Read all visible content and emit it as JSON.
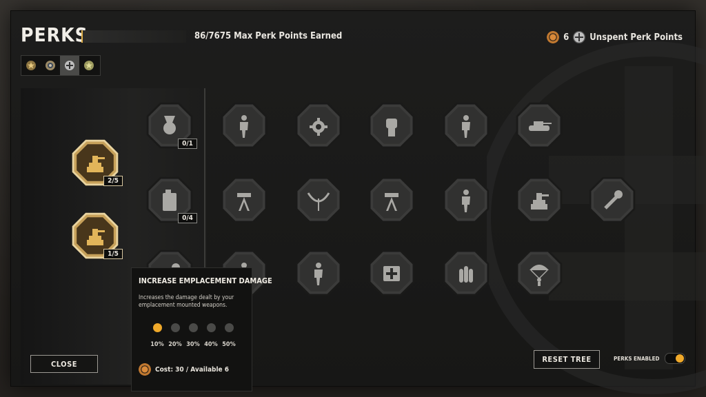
{
  "header": {
    "title": "PERKS",
    "max_points_text": "86/7675 Max Perk Points Earned",
    "progress_fraction": 0.011,
    "unspent_count": "6",
    "unspent_label": "Unspent Perk Points"
  },
  "faction_tabs": [
    {
      "icon": "star-medal-icon",
      "active": false
    },
    {
      "icon": "ring-medal-icon",
      "active": false
    },
    {
      "icon": "iron-cross-icon",
      "active": true
    },
    {
      "icon": "green-star-medal-icon",
      "active": false
    }
  ],
  "perks": {
    "column1": [
      {
        "icon": "emplacement-upgrade-icon",
        "count": "2/5",
        "style": "gold"
      },
      {
        "icon": "emplacement-damage-icon",
        "count": "1/5",
        "style": "gold"
      }
    ],
    "column2": [
      {
        "icon": "medal-skull-icon",
        "count": "0/1"
      },
      {
        "icon": "fuel-can-icon",
        "count": "0/4"
      },
      {
        "icon": "wrench-icon",
        "count": ""
      }
    ],
    "grid": [
      [
        "soldier-clock-icon",
        "gear-plus-icon",
        "fist-plus-icon",
        "soldier-up-icon",
        "tank-plus-icon"
      ],
      [
        "mg-tripod-shield-icon",
        "bow-wire-icon",
        "mg-tripod-bullets-icon",
        "soldier-shield-icon",
        "emplacement-shield-icon",
        "wrench-plus-icon"
      ],
      [
        "soldier-up-icon",
        "soldier-running-plus-icon",
        "medkit-icon",
        "ammo-icon",
        "paratrooper-icon"
      ]
    ]
  },
  "tooltip": {
    "title": "INCREASE EMPLACEMENT DAMAGE",
    "description": "Increases the damage dealt by your emplacement mounted weapons.",
    "levels": [
      "10%",
      "20%",
      "30%",
      "40%",
      "50%"
    ],
    "active_levels": 1,
    "cost_text": "Cost: 30 / Available 6"
  },
  "buttons": {
    "close_label": "CLOSE",
    "reset_label": "RESET TREE"
  },
  "toggle": {
    "label": "PERKS ENABLED",
    "enabled": true
  },
  "colors": {
    "accent": "#efa92a",
    "gold": "#c8a35a"
  }
}
